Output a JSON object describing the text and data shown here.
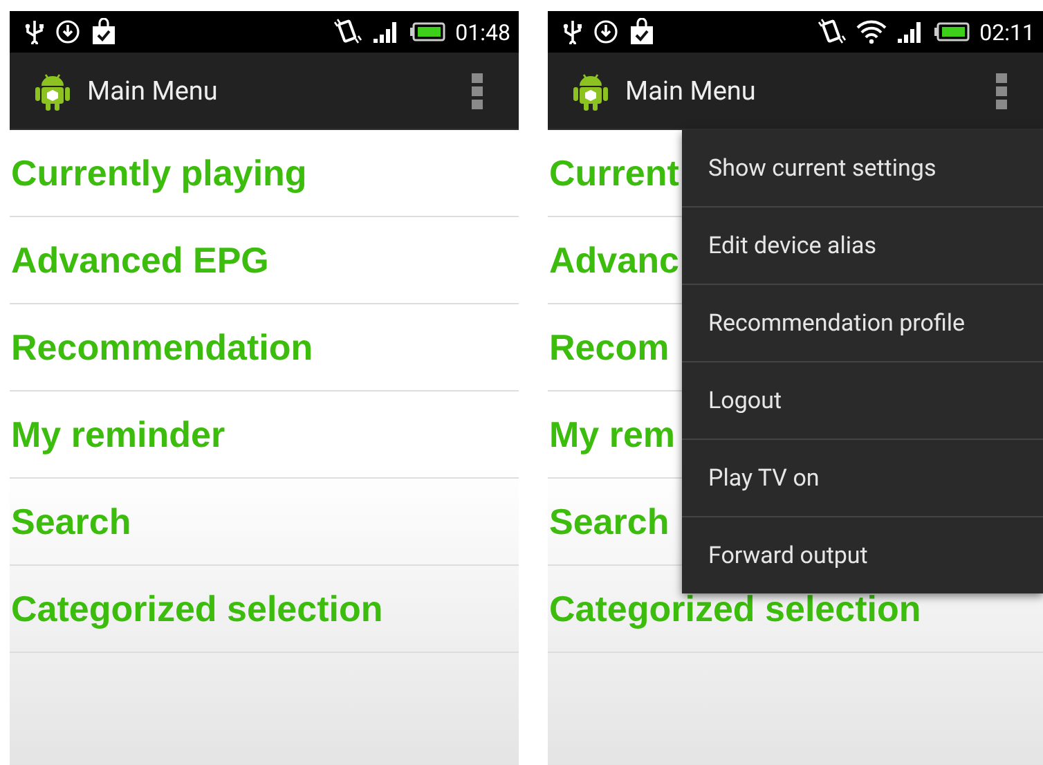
{
  "screens": [
    {
      "status_bar": {
        "time": "01:48",
        "wifi": false
      },
      "action_bar": {
        "title": "Main Menu"
      },
      "menu_items": [
        "Currently playing",
        "Advanced EPG",
        "Recommendation",
        "My reminder",
        "Search",
        "Categorized selection"
      ]
    },
    {
      "status_bar": {
        "time": "02:11",
        "wifi": true
      },
      "action_bar": {
        "title": "Main Menu"
      },
      "menu_items": [
        "Current",
        "Advanc",
        "Recom",
        "My rem",
        "Search",
        "Categorized selection"
      ],
      "overflow_menu": [
        "Show current settings",
        "Edit device alias",
        "Recommendation profile",
        "Logout",
        "Play TV on",
        "Forward output"
      ]
    }
  ]
}
